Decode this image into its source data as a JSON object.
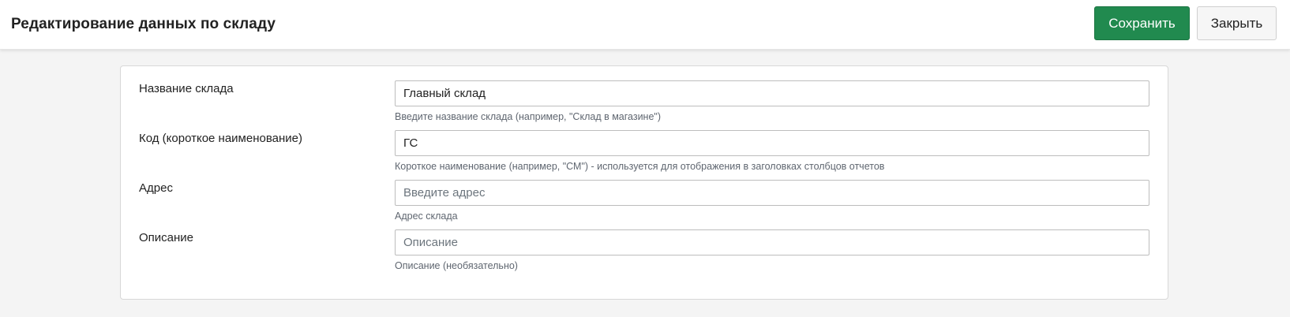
{
  "header": {
    "title": "Редактирование данных по складу",
    "save_label": "Сохранить",
    "close_label": "Закрыть",
    "save_color": "#218a4f"
  },
  "form": {
    "name": {
      "label": "Название склада",
      "value": "Главный склад",
      "help": "Введите название склада (например, \"Склад в магазине\")"
    },
    "code": {
      "label": "Код (короткое наименование)",
      "value": "ГС",
      "help": "Короткое наименование (например, \"СМ\") - используется для отображения в заголовках столбцов отчетов"
    },
    "address": {
      "label": "Адрес",
      "value": "",
      "placeholder": "Введите адрес",
      "help": "Адрес склада"
    },
    "description": {
      "label": "Описание",
      "value": "",
      "placeholder": "Описание",
      "help": "Описание (необязательно)"
    }
  }
}
